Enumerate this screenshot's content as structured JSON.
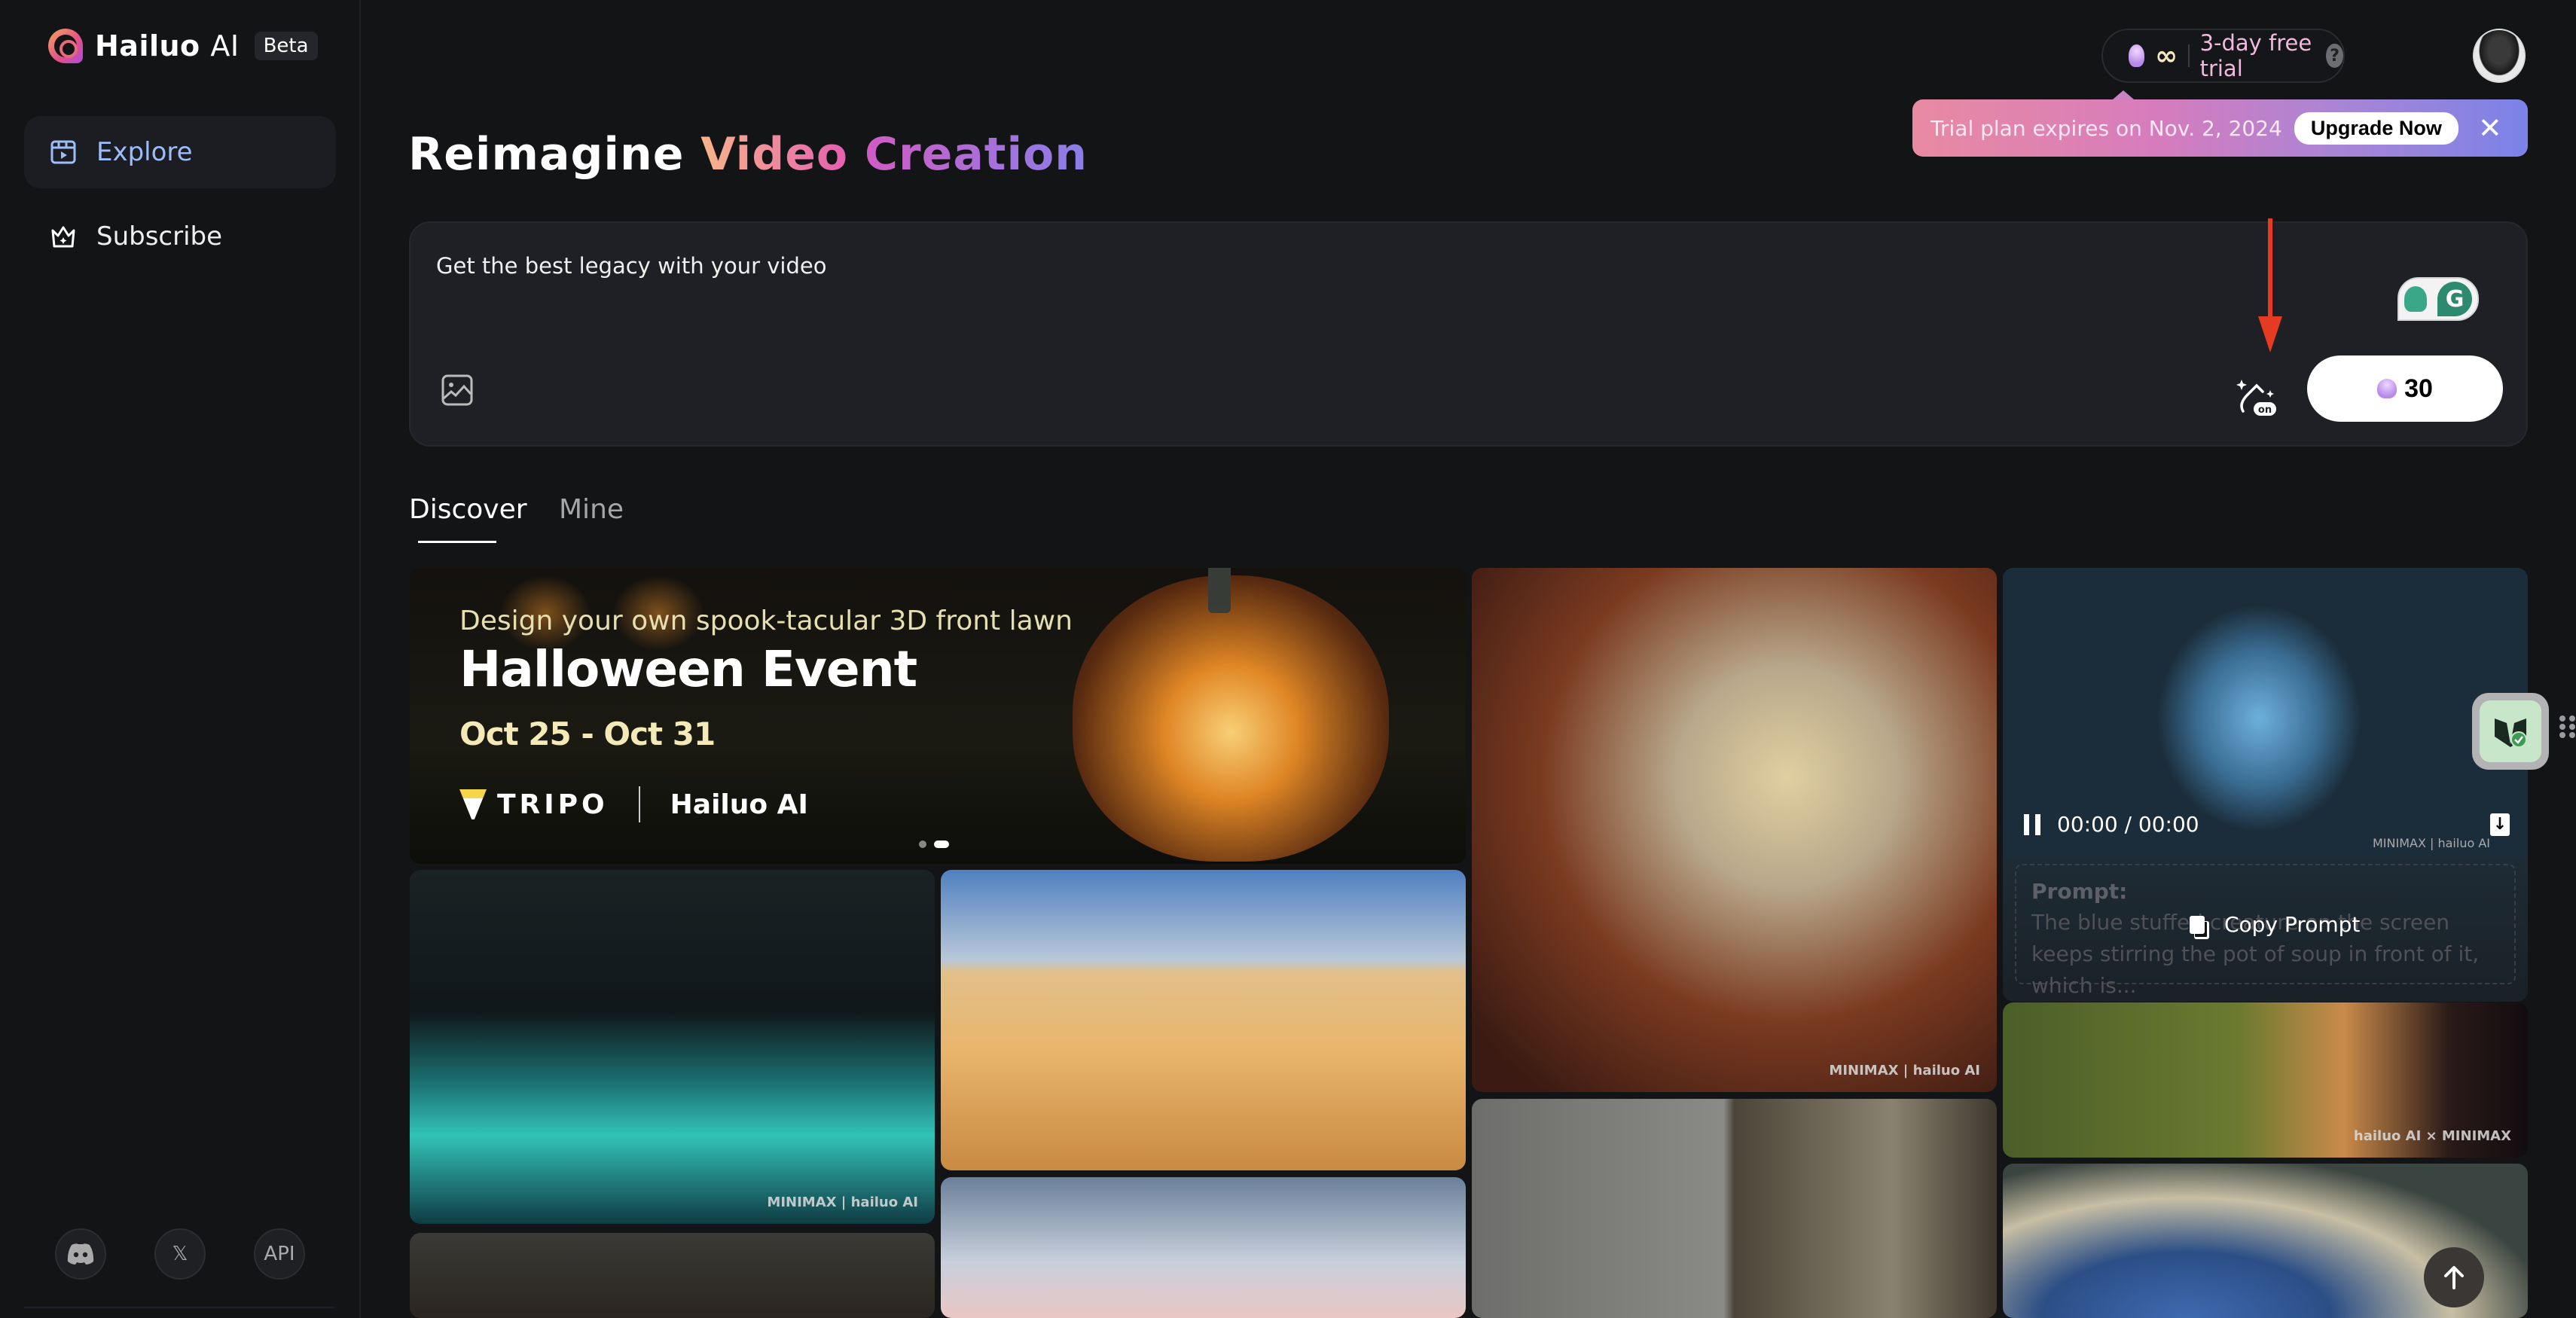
{
  "app": {
    "brand_name": "Hailuo",
    "brand_suffix": "AI",
    "badge": "Beta"
  },
  "sidebar": {
    "items": [
      {
        "label": "Explore",
        "icon": "video-library-icon",
        "active": true
      },
      {
        "label": "Subscribe",
        "icon": "crown-icon",
        "active": false
      }
    ],
    "social": [
      {
        "label": "",
        "icon": "discord-icon"
      },
      {
        "label": "𝕏",
        "icon": "x-twitter-icon"
      },
      {
        "label": "API",
        "icon": "api-icon"
      }
    ]
  },
  "header": {
    "credits_symbol": "∞",
    "trial_text": "3-day free trial",
    "help_symbol": "?",
    "banner_text": "Trial plan expires on Nov. 2, 2024",
    "upgrade_label": "Upgrade Now",
    "close_symbol": "✕"
  },
  "hero": {
    "title_part1": "Reimagine",
    "title_part2": "Video",
    "title_part3": "Creation"
  },
  "prompt": {
    "value": "Get the best legacy with your video",
    "enhance_badge": "on",
    "grammarly_letter": "G",
    "generate_cost": "30"
  },
  "tabs": [
    {
      "label": "Discover",
      "active": true
    },
    {
      "label": "Mine",
      "active": false
    }
  ],
  "gallery": {
    "featured": {
      "subtitle": "Design your own spook-tacular 3D front lawn",
      "title": "Halloween Event",
      "dates": "Oct 25 - Oct 31",
      "partner1": "TRIPO",
      "partner2": "Hailuo AI",
      "carousel_total": 2,
      "carousel_active": 2
    },
    "watermark1": "MINIMAX | hailuo AI",
    "watermark2": "hailuo AI × MINIMAX",
    "video_card": {
      "time": "00:00 / 00:00",
      "prompt_label": "Prompt:",
      "prompt_text": "The blue stuffed creature on the screen keeps stirring the pot of soup in front of it, which is...",
      "copy_label": "Copy Prompt",
      "watermark": "MINIMAX | hailuo AI"
    }
  },
  "floating": {
    "scroll_top_symbol": "↑"
  }
}
